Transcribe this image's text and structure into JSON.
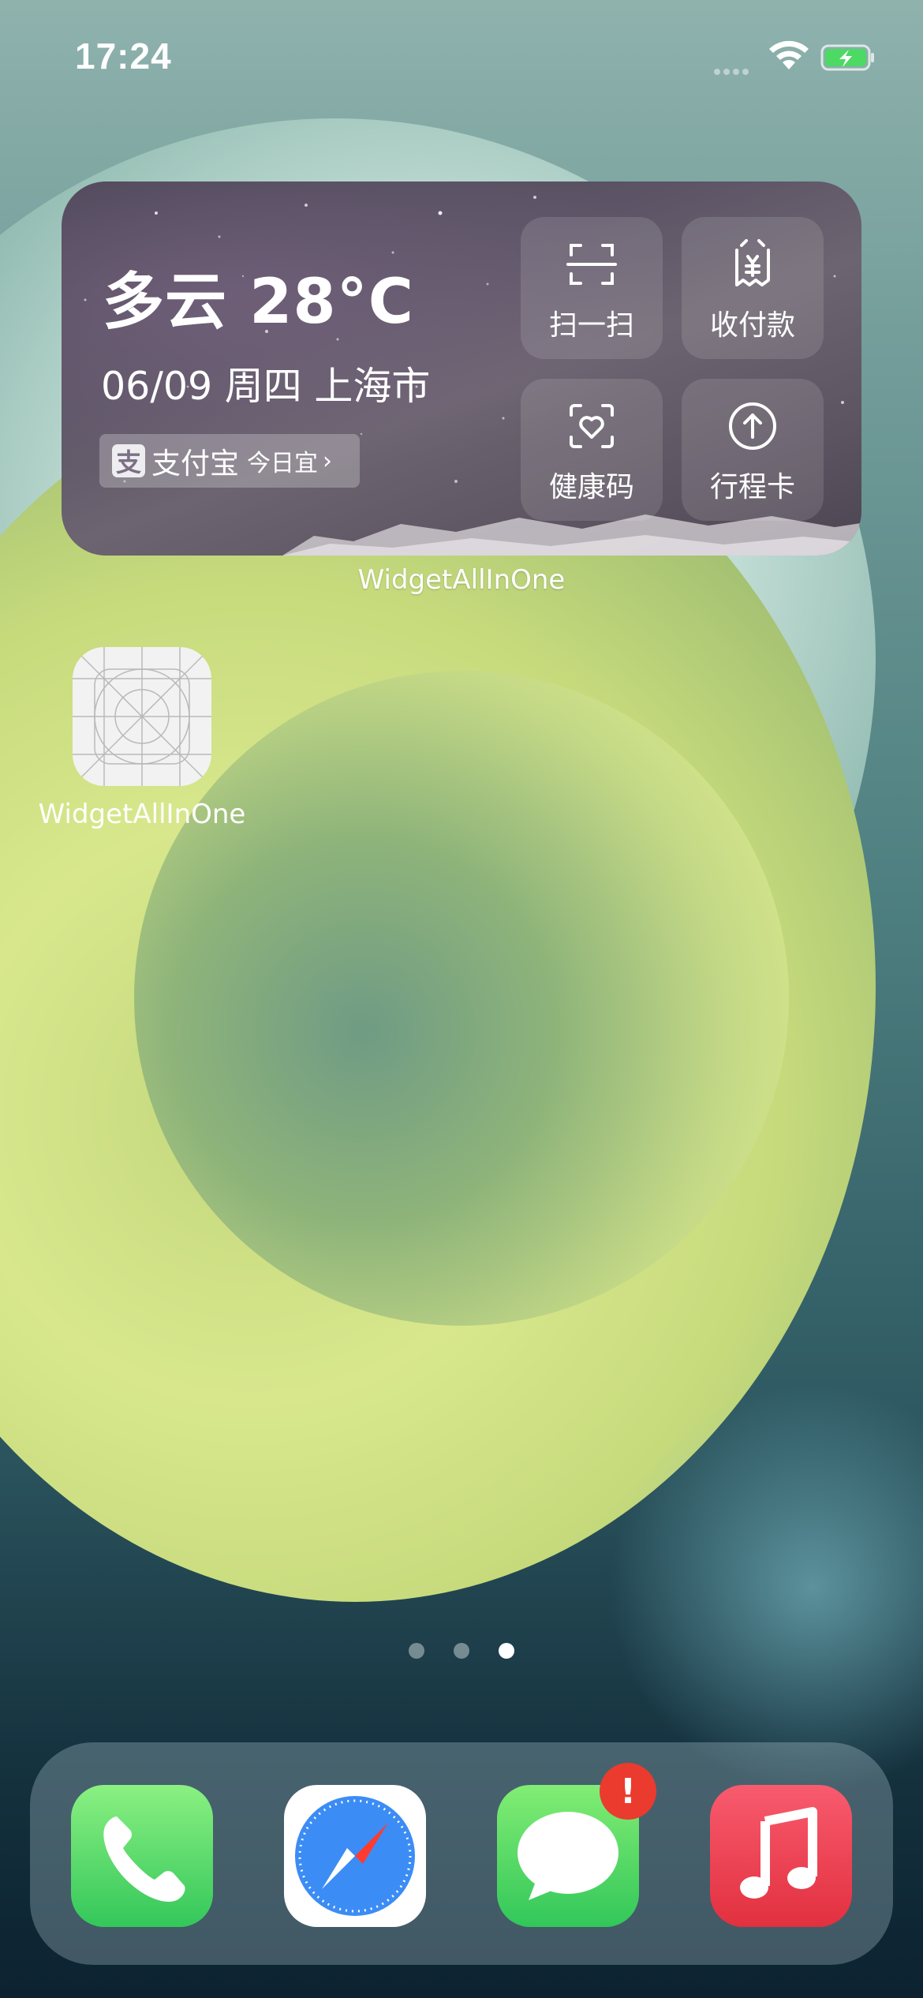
{
  "status_bar": {
    "time": "17:24"
  },
  "widget": {
    "weather_title": "多云 28°C",
    "date_line": "06/09 周四 上海市",
    "pill": {
      "logo_char": "支",
      "brand": "支付宝",
      "subtitle": "今日宜",
      "arrow": "›"
    },
    "buttons": [
      {
        "label": "扫一扫",
        "icon": "scan-icon"
      },
      {
        "label": "收付款",
        "icon": "payment-receipt-icon"
      },
      {
        "label": "健康码",
        "icon": "health-code-icon"
      },
      {
        "label": "行程卡",
        "icon": "upload-arrow-icon"
      }
    ],
    "caption": "WidgetAllInOne"
  },
  "home_apps": [
    {
      "label": "WidgetAllInOne",
      "icon": "app-placeholder-icon"
    }
  ],
  "page_indicator": {
    "count": 3,
    "active": 3
  },
  "dock": {
    "apps": [
      {
        "name": "phone",
        "icon": "phone-icon"
      },
      {
        "name": "safari",
        "icon": "compass-icon"
      },
      {
        "name": "messages",
        "icon": "speech-bubble-icon",
        "badge": "!"
      },
      {
        "name": "music",
        "icon": "music-note-icon"
      }
    ]
  },
  "colors": {
    "badge": "#ea3b2e",
    "battery_fill": "#4cd964",
    "phone_green": "#34c75a",
    "music_red": "#e2303f"
  }
}
